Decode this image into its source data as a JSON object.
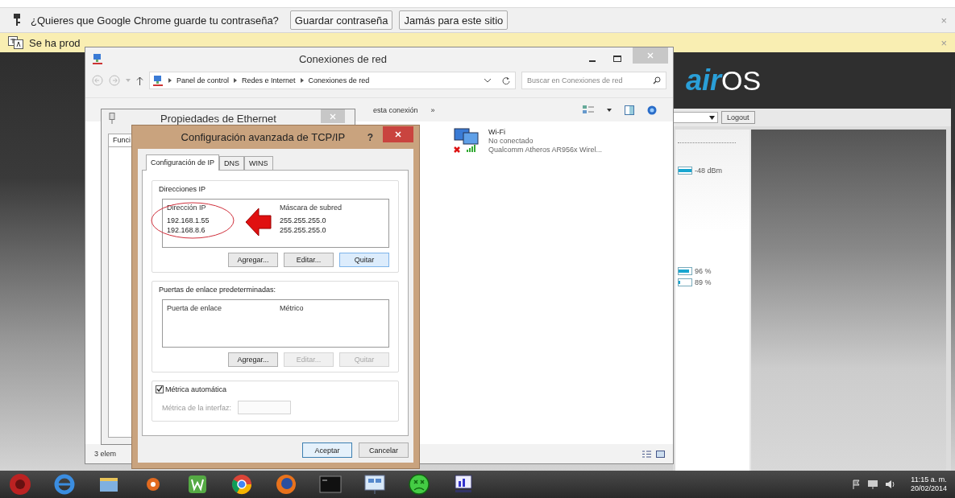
{
  "password_bar": {
    "message": "¿Quieres que Google Chrome guarde tu contraseña?",
    "buttons": [
      "Guardar contraseña",
      "Jamás para este sitio"
    ],
    "close": "×"
  },
  "translate_bar": {
    "message": "Se ha prod",
    "close": "×"
  },
  "airos": {
    "logo_prefix": "air",
    "logo_suffix": "OS",
    "logout": "Logout",
    "readings": [
      {
        "level": 1,
        "reading": "-48 dBm"
      },
      {
        "level": 0.8,
        "reading": "96 %"
      },
      {
        "level": 0.15,
        "reading": "89 %"
      }
    ]
  },
  "explorer": {
    "title": "Conexiones de red",
    "breadcrumb": [
      "Panel de control",
      "Redes e Internet",
      "Conexiones de red"
    ],
    "search": {
      "placeholder": "Buscar en Conexiones de red"
    },
    "toolbar": [
      "esta conexión",
      "»"
    ],
    "connections": [
      {
        "name": "Wi-Fi",
        "status": "No conectado",
        "adapter": "Qualcomm Atheros AR956x Wirel..."
      }
    ],
    "status_bar": "3 elem"
  },
  "ethernet_properties": {
    "title": "Propiedades de Ethernet",
    "tab": "Funci"
  },
  "tcpip": {
    "title": "Configuración avanzada de TCP/IP",
    "help": "?",
    "tabs": [
      {
        "label": "Configuración de IP",
        "selected": true
      },
      {
        "label": "DNS",
        "selected": false
      },
      {
        "label": "WINS",
        "selected": false
      }
    ],
    "ip_group": {
      "title": "Direcciones IP",
      "columns": [
        "Dirección IP",
        "Máscara de subred"
      ],
      "rows": [
        [
          "192.168.1.55",
          "255.255.255.0"
        ],
        [
          "192.168.8.6",
          "255.255.255.0"
        ]
      ],
      "buttons": [
        {
          "label": "Agregar...",
          "disabled": false,
          "highlighted": false
        },
        {
          "label": "Editar...",
          "disabled": false,
          "highlighted": false
        },
        {
          "label": "Quitar",
          "disabled": false,
          "highlighted": true
        }
      ]
    },
    "gateway_group": {
      "title": "Puertas de enlace predeterminadas:",
      "columns": [
        "Puerta de enlace",
        "Métrico"
      ],
      "buttons": [
        {
          "label": "Agregar...",
          "disabled": false,
          "highlighted": false
        },
        {
          "label": "Editar...",
          "disabled": true,
          "highlighted": false
        },
        {
          "label": "Quitar",
          "disabled": true,
          "highlighted": false
        }
      ]
    },
    "metric": {
      "label": "Métrica automática",
      "checked": true,
      "field_label": "Métrica de la interfaz:",
      "field_disabled": true
    },
    "footer_buttons": [
      {
        "label": "Aceptar",
        "default": true
      },
      {
        "label": "Cancelar",
        "default": false
      }
    ]
  },
  "taskbar": {
    "apps": [
      {
        "kind": "start"
      },
      {
        "kind": "ie"
      },
      {
        "kind": "folder"
      },
      {
        "kind": "media"
      },
      {
        "kind": "w"
      },
      {
        "kind": "chrome"
      },
      {
        "kind": "firefox"
      },
      {
        "kind": "cmd"
      },
      {
        "kind": "network"
      },
      {
        "kind": "face"
      },
      {
        "kind": "monitor"
      }
    ],
    "time": "11:15 a. m.",
    "date": "20/02/2014"
  }
}
